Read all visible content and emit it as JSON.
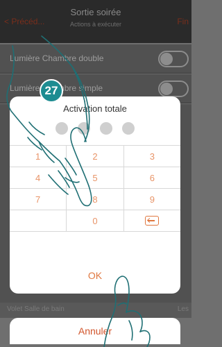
{
  "header": {
    "back_label": "< Précéd...",
    "title": "Sortie soirée",
    "subtitle": "Actions à exécuter",
    "finish_label": "Fin"
  },
  "background_rows": [
    {
      "label": "Lumière Chambre double"
    },
    {
      "label": "Lumière Chambre simple"
    }
  ],
  "background_bottom": {
    "label": "Volet Salle de bain",
    "right": "Les"
  },
  "step_badge": "27",
  "dialog": {
    "title": "Activation totale",
    "pin_length": 4,
    "keys": [
      [
        "1",
        "2",
        "3"
      ],
      [
        "4",
        "5",
        "6"
      ],
      [
        "7",
        "8",
        "9"
      ],
      [
        "",
        "0",
        "backspace"
      ]
    ],
    "ok_label": "OK",
    "cancel_label": "Annuler"
  },
  "colors": {
    "accent": "#e07840",
    "key_text": "#e89468",
    "cancel_text": "#d1542b",
    "badge": "#1d8c91"
  }
}
